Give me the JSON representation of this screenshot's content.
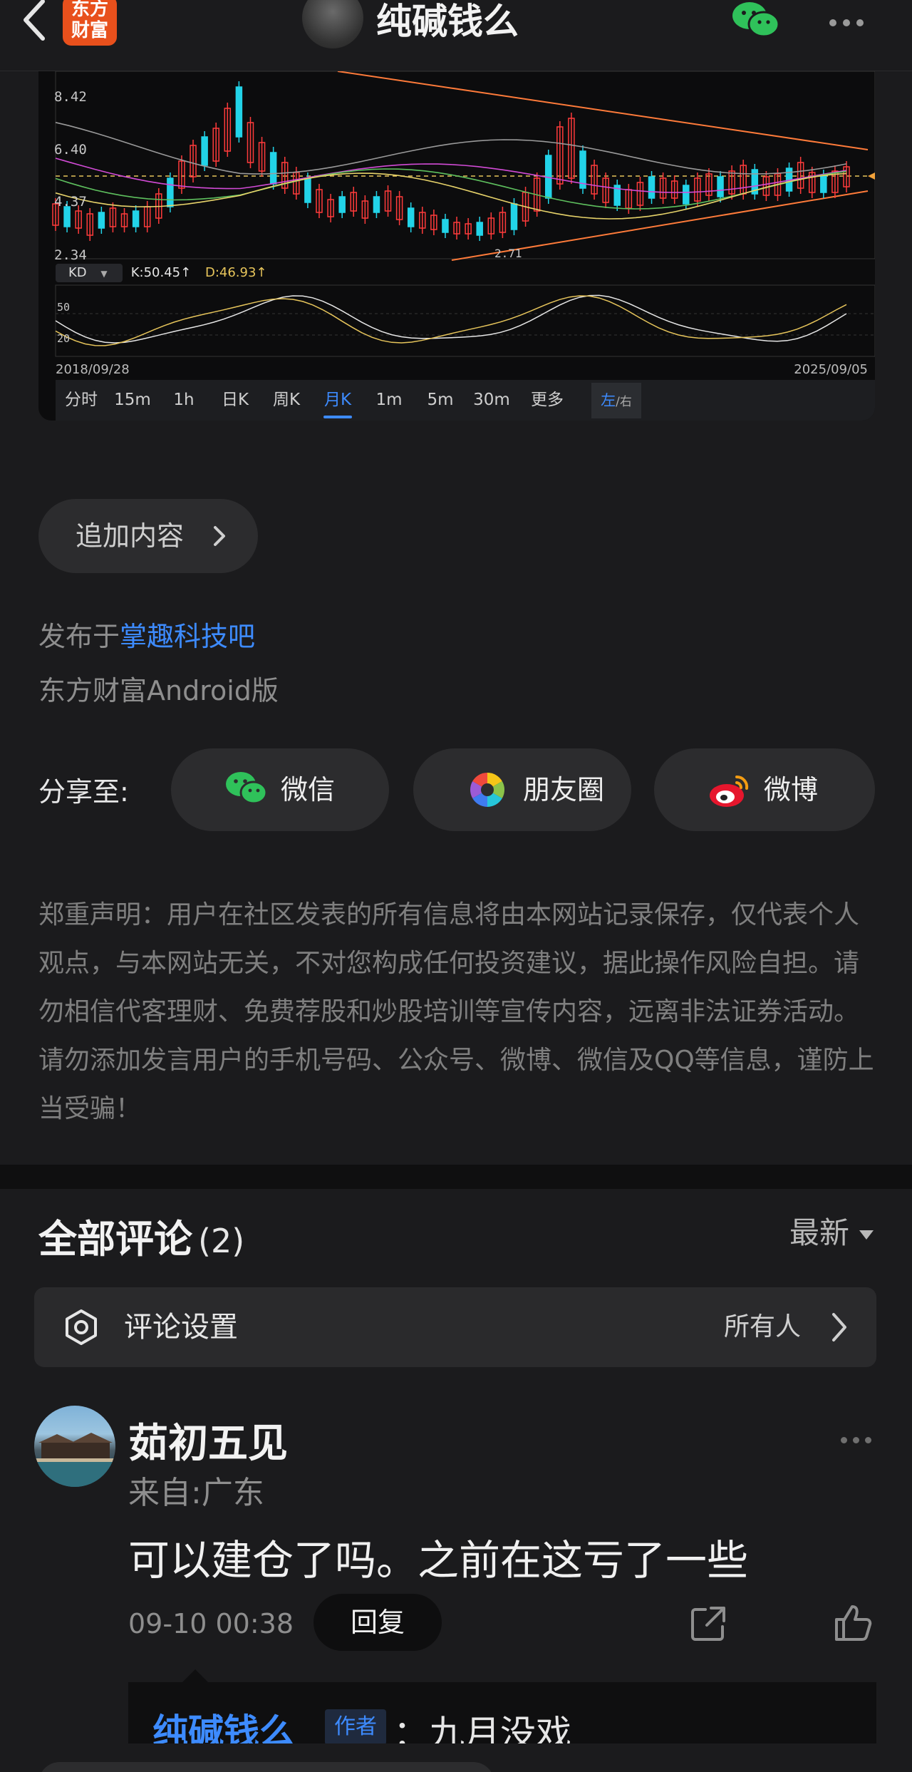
{
  "header": {
    "logo_text_line1": "东方",
    "logo_text_line2": "财富",
    "title": "纯碱钱么"
  },
  "chart": {
    "price_labels": [
      "8.42",
      "6.40",
      "4.37",
      "2.34"
    ],
    "low_annotation": "2.71",
    "indicator_select": "KD",
    "k_value": "K:50.45↑",
    "d_value": "D:46.93↑",
    "kd_levels": [
      "50",
      "20"
    ],
    "date_start": "2018/09/28",
    "date_end": "2025/09/05",
    "periods": [
      "分时",
      "15m",
      "1h",
      "日K",
      "周K",
      "月K",
      "1m",
      "5m",
      "30m",
      "更多"
    ],
    "active_period": "月K",
    "lr_left": "左",
    "lr_right": "右",
    "colors": {
      "up": "#ff3b3b",
      "down": "#22d3e8",
      "accent": "#3d8bff",
      "trend": "#ff7b3a"
    }
  },
  "chart_data": {
    "type": "candlestick",
    "title": "",
    "xlabel": "",
    "ylabel": "",
    "ylim": [
      2.34,
      8.42
    ],
    "x_range": [
      "2018/09/28",
      "2025/09/05"
    ],
    "y_ticks": [
      8.42,
      6.4,
      4.37,
      2.34
    ],
    "annotations": [
      "2.71"
    ],
    "indicator": {
      "name": "KD",
      "K": 50.45,
      "D": 46.93,
      "levels": [
        50,
        20
      ]
    }
  },
  "actions": {
    "add_content": "追加内容"
  },
  "post_meta": {
    "published_prefix": "发布于",
    "forum": "掌趣科技吧",
    "client": "东方财富Android版"
  },
  "share": {
    "label": "分享至:",
    "wechat": "微信",
    "moments": "朋友圈",
    "weibo": "微博"
  },
  "disclaimer": "郑重声明：用户在社区发表的所有信息将由本网站记录保存，仅代表个人观点，与本网站无关，不对您构成任何投资建议，据此操作风险自担。请勿相信代客理财、免费荐股和炒股培训等宣传内容，远离非法证券活动。请勿添加发言用户的手机号码、公众号、微博、微信及QQ等信息，谨防上当受骗！",
  "comments": {
    "title": "全部评论",
    "count": "(2)",
    "sort": "最新",
    "settings_label": "评论设置",
    "settings_value": "所有人",
    "items": [
      {
        "author": "茹初五见",
        "from": "来自:广东",
        "text": "可以建仓了吗。之前在这亏了一些",
        "time": "09-10 00:38",
        "reply_btn": "回复",
        "reply": {
          "author": "纯碱钱么",
          "tag": "作者",
          "text": "：九月没戏"
        }
      }
    ]
  }
}
